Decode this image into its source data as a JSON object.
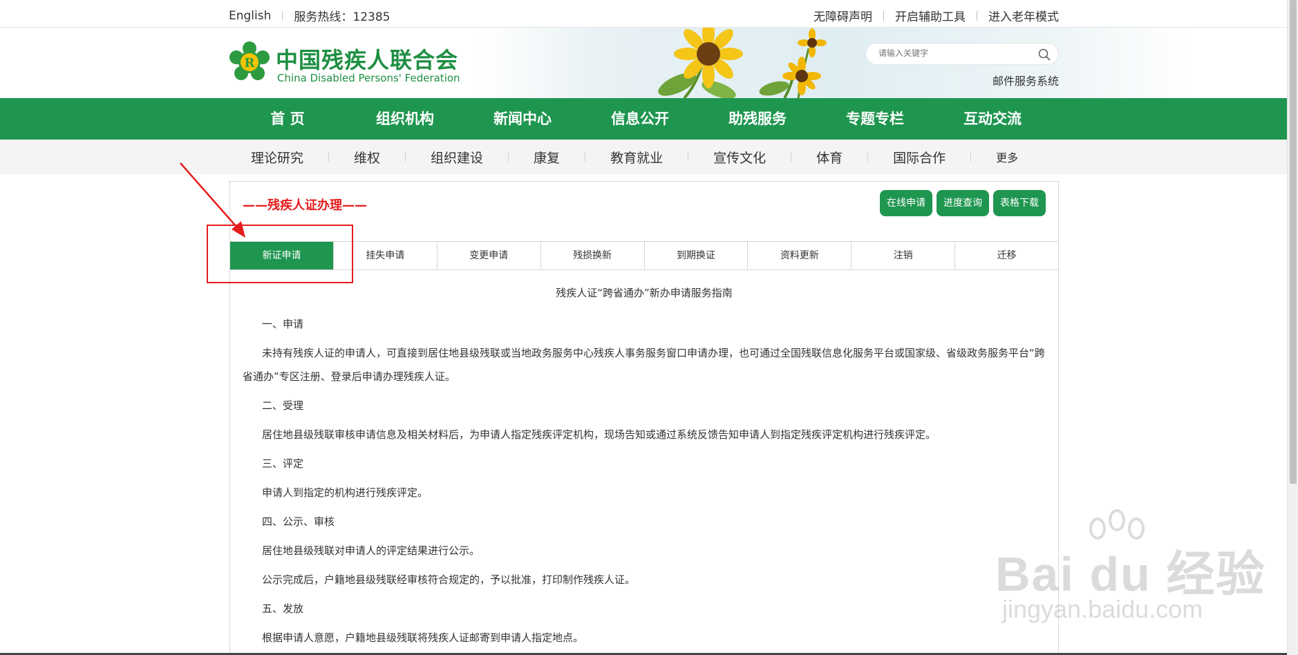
{
  "topbar": {
    "english": "English",
    "hotline": "服务热线：12385",
    "accessibility": "无障碍声明",
    "assist_tools": "开启辅助工具",
    "elder_mode": "进入老年模式"
  },
  "header": {
    "logo_cn": "中国残疾人联合会",
    "logo_en": "China Disabled Persons' Federation",
    "search_placeholder": "请输入关键字",
    "mail_link": "邮件服务系统"
  },
  "main_nav": [
    "首 页",
    "组织机构",
    "新闻中心",
    "信息公开",
    "助残服务",
    "专题专栏",
    "互动交流"
  ],
  "sub_nav": [
    "理论研究",
    "维权",
    "组织建设",
    "康复",
    "教育就业",
    "宣传文化",
    "体育",
    "国际合作",
    "更多"
  ],
  "box": {
    "title": "——残疾人证办理——",
    "buttons": [
      "在线申请",
      "进度查询",
      "表格下载"
    ],
    "tabs": [
      "新证申请",
      "挂失申请",
      "变更申请",
      "残损换新",
      "到期换证",
      "资料更新",
      "注销",
      "迁移"
    ],
    "active_tab": 0
  },
  "article": {
    "title": "残疾人证“跨省通办”新办申请服务指南",
    "paragraphs": [
      "一、申请",
      "未持有残疾人证的申请人，可直接到居住地县级残联或当地政务服务中心残疾人事务服务窗口申请办理，也可通过全国残联信息化服务平台或国家级、省级政务服务平台“跨省通办”专区注册、登录后申请办理残疾人证。",
      "二、受理",
      "居住地县级残联审核申请信息及相关材料后，为申请人指定残疾评定机构，现场告知或通过系统反馈告知申请人到指定残疾评定机构进行残疾评定。",
      "三、评定",
      "申请人到指定的机构进行残疾评定。",
      "四、公示、审核",
      "居住地县级残联对申请人的评定结果进行公示。",
      "公示完成后，户籍地县级残联经审核符合规定的，予以批准，打印制作残疾人证。",
      "五、发放",
      "根据申请人意愿，户籍地县级残联将残疾人证邮寄到申请人指定地点。"
    ]
  },
  "watermark": {
    "main": "Bai du 经验",
    "url": "jingyan.baidu.com"
  },
  "colors": {
    "brand_green": "#1f9650",
    "annotation_red": "#e61c1c"
  }
}
